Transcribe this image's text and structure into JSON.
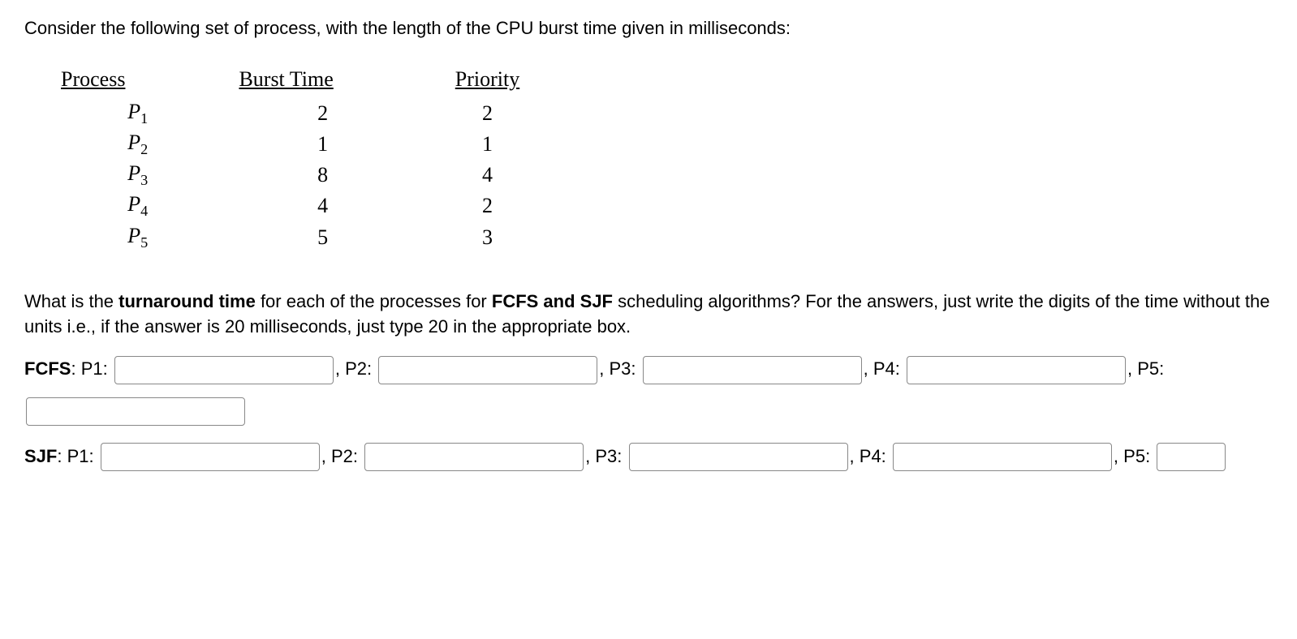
{
  "intro": "Consider the following set of process, with the length of the CPU burst time given in milliseconds:",
  "table": {
    "headers": [
      "Process",
      "Burst Time",
      "Priority"
    ],
    "rows": [
      {
        "name": "P",
        "sub": "1",
        "burst": "2",
        "priority": "2"
      },
      {
        "name": "P",
        "sub": "2",
        "burst": "1",
        "priority": "1"
      },
      {
        "name": "P",
        "sub": "3",
        "burst": "8",
        "priority": "4"
      },
      {
        "name": "P",
        "sub": "4",
        "burst": "4",
        "priority": "2"
      },
      {
        "name": "P",
        "sub": "5",
        "burst": "5",
        "priority": "3"
      }
    ]
  },
  "question_parts": {
    "p1": "What is the ",
    "b1": "turnaround time",
    "p2": " for each of the processes for ",
    "b2": "FCFS and SJF",
    "p3": " scheduling algorithms? For the answers, just write the digits of the time without the units i.e., if the answer is 20 milliseconds, just type 20 in the appropriate box."
  },
  "labels": {
    "fcfs": "FCFS",
    "sjf": "SJF",
    "p1": "P1:",
    "p2": "P2:",
    "p3": "P3:",
    "p4": "P4:",
    "p5": "P5:",
    "colon": ": ",
    "comma": ", "
  }
}
